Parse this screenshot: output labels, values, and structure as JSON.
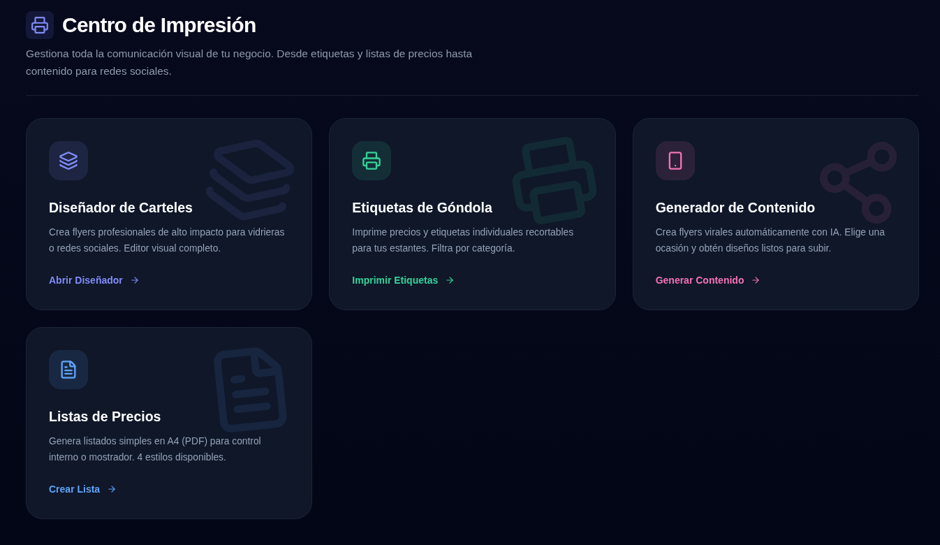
{
  "header": {
    "title": "Centro de Impresión",
    "description": "Gestiona toda la comunicación visual de tu negocio. Desde etiquetas y listas de precios hasta contenido para redes sociales."
  },
  "cards": [
    {
      "title": "Diseñador de Carteles",
      "description": "Crea flyers profesionales de alto impacto para vidrieras o redes sociales. Editor visual completo.",
      "action": "Abrir Diseñador",
      "color": "#818cf8"
    },
    {
      "title": "Etiquetas de Góndola",
      "description": "Imprime precios y etiquetas individuales recortables para tus estantes. Filtra por categoría.",
      "action": "Imprimir Etiquetas",
      "color": "#34d399"
    },
    {
      "title": "Generador de Contenido",
      "description": "Crea flyers virales automáticamente con IA. Elige una ocasión y obtén diseños listos para subir.",
      "action": "Generar Contenido",
      "color": "#f472b6"
    },
    {
      "title": "Listas de Precios",
      "description": "Genera listados simples en A4 (PDF) para control interno o mostrador. 4 estilos disponibles.",
      "action": "Crear Lista",
      "color": "#60a5fa"
    }
  ]
}
